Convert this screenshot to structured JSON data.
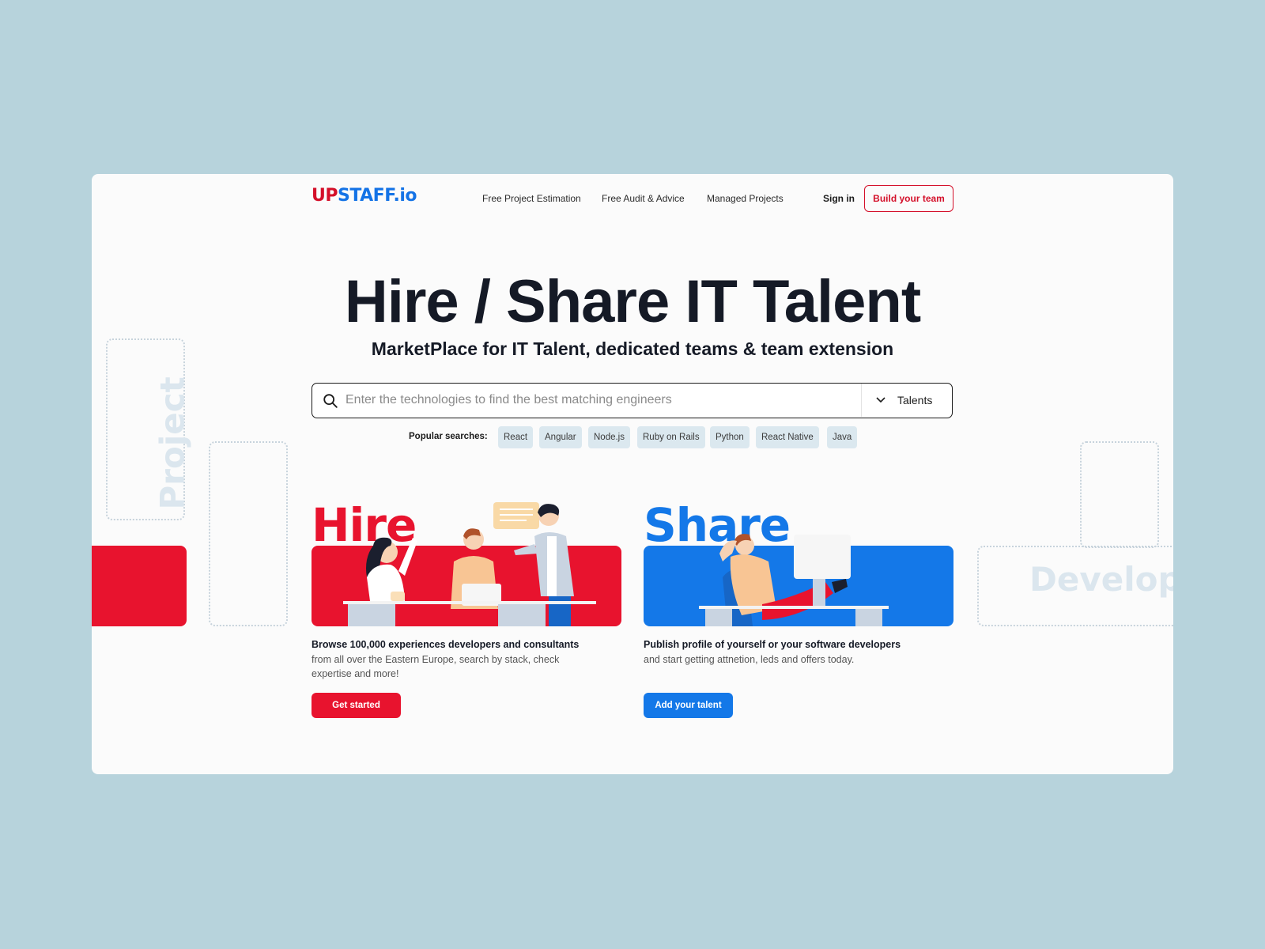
{
  "header": {
    "logo": {
      "prefix": "UP",
      "rest": "STAFF.io"
    },
    "nav": [
      {
        "label": "Free Project Estimation"
      },
      {
        "label": "Free Audit & Advice"
      },
      {
        "label": "Managed Projects"
      }
    ],
    "sign_in": "Sign in",
    "cta": "Build your team"
  },
  "hero": {
    "title": "Hire / Share IT Talent",
    "subtitle": "MarketPlace for IT Talent, dedicated teams & team extension"
  },
  "search": {
    "placeholder": "Enter the technologies to find the best matching engineers",
    "value": "",
    "icon": "search-icon",
    "dropdown": {
      "selected": "Talents",
      "icon": "chevron-down-icon"
    }
  },
  "popular": {
    "label": "Popular searches:",
    "chips": [
      "React",
      "Angular",
      "Node.js",
      "Ruby on Rails",
      "Python",
      "React Native",
      "Java"
    ]
  },
  "panels": {
    "hire": {
      "word": "Hire",
      "title": "Browse 100,000 experiences developers and consultants",
      "description": "from all over the Eastern Europe, search by stack, check expertise and more!",
      "button": "Get started",
      "color": "#e8132e"
    },
    "share": {
      "word": "Share",
      "title": "Publish profile of yourself or your software developers",
      "description": "and start getting attnetion, leds and offers today.",
      "button": "Add your talent",
      "color": "#1478e8"
    }
  },
  "decorations": {
    "left_word": "Project",
    "right_word": "Develop"
  },
  "colors": {
    "background": "#b7d3dc",
    "card": "#fbfbfb",
    "brand_red": "#d4102a",
    "brand_blue": "#1473e6",
    "chip_bg": "#dbe8ef"
  }
}
